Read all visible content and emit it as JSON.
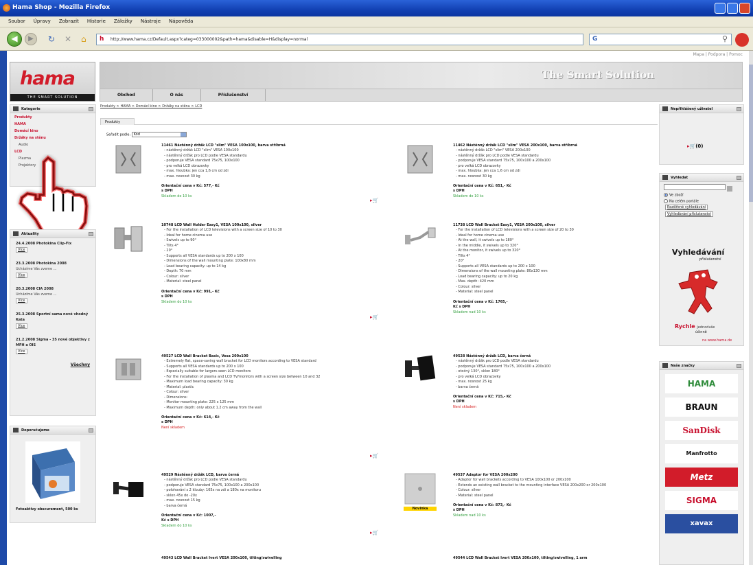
{
  "window": {
    "title": "Hama Shop - Mozilla Firefox"
  },
  "menu": [
    "Soubor",
    "Úpravy",
    "Zobrazit",
    "Historie",
    "Záložky",
    "Nástroje",
    "Nápověda"
  ],
  "nav": {
    "url": "http://www.hama.cz/Default.aspx?categ=033000002&path=hama&disable=H&display=normal",
    "search_placeholder": "Google"
  },
  "header": {
    "toplinks": "Mapa | Podpora | Pomoc",
    "logo": "hama",
    "logo_strip": "THE SMART SOLUTION",
    "slogan": "The Smart Solution",
    "tabs": [
      "Obchod",
      "O nás",
      "Příslušenství"
    ]
  },
  "sidebar": {
    "categories_title": "Kategorie",
    "categories": [
      {
        "label": "Produkty",
        "sub": false
      },
      {
        "label": "HAMA",
        "sub": false
      },
      {
        "label": "Domácí kino",
        "sub": false
      },
      {
        "label": "Držáky na stěnu",
        "sub": false
      },
      {
        "label": "Audio",
        "sub": true
      },
      {
        "label": "LCD",
        "sub": false
      },
      {
        "label": "Plazma",
        "sub": true
      },
      {
        "label": "Projektory",
        "sub": true
      }
    ],
    "news_title": "Aktuality",
    "news": [
      {
        "title": "24.4.2008 Photokina Clip-Fix",
        "desc": "",
        "more": "Více"
      },
      {
        "title": "23.3.2008 Photokina 2008",
        "desc": "Ucházíme Vás zveme ...",
        "more": "Více"
      },
      {
        "title": "20.3.2008 CIA 2008",
        "desc": "Ucházíme Vás zveme ...",
        "more": "Více"
      },
      {
        "title": "25.3.2008 Sportní sama nové vhodný Kata",
        "desc": "",
        "more": "Více"
      },
      {
        "title": "21.2.2008 Sigma - 35 nové objektivy z MFH a OIS",
        "desc": "",
        "more": "Více"
      }
    ],
    "news_all": "Všechny",
    "promo_title": "Doporučujeme",
    "promo_caption": "Fotoaktivy obscurement, 500 ks"
  },
  "main": {
    "breadcrumb": "Produkty > HAMA > Domácí kino > Držáky na stěnu > LCD",
    "tab": "Produkty",
    "sort_label": "Seřadit podle:",
    "sort_value": "Kód",
    "products": [
      {
        "name": "11461 Nástěnný držák LCD \"slim\" VESA 100x100, barva stříbrná",
        "features": [
          "nástěnný držák LCD \"slim\" VESA 100x100",
          "nástěnný držák pro LCD podle VESA standardu",
          "podporuje VESA standard 75x75, 100x100",
          "pro velká LCD obrazovky",
          "max. hloubka: jen cca 1,6 cm od zdi",
          "max. nosnost 30 kg"
        ],
        "price": "Orientační cena v Kč: 577,- Kč",
        "price2": "s DPH",
        "availability": "Skladem do 10 ks",
        "avail_color": "green"
      },
      {
        "name": "11462 Nástěnný držák LCD \"slim\" VESA 200x100, barva stříbrná",
        "features": [
          "nástěnný držák LCD \"slim\" VESA 200x100",
          "nástěnný držák pro LCD podle VESA standardu",
          "podporuje VESA standard 75x75, 100x100 a 200x100",
          "pro velká LCD obrazovky",
          "max. hloubka: jen cca 1,6 cm od zdi",
          "max. nosnost 30 kg"
        ],
        "price": "Orientační cena v Kč: 651,- Kč",
        "price2": "s DPH",
        "availability": "Skladem do 10 ks",
        "avail_color": "green"
      },
      {
        "name": "10748 LCD Wall Holder Easy1, VESA 100x100, silver",
        "features": [
          "For the installation of LCD televisions with a screen size of 10 to 30",
          "Ideal for home cinema use",
          "Swivels up to 90°",
          "Tilts 4°",
          "20°",
          "Supports all VESA standards up to 200 x 100",
          "Dimensions of the wall mounting plate: 100x80 mm",
          "Load bearing capacity: up to 14 kg",
          "Depth: 70 mm",
          "Colour: silver",
          "Material: steel panel"
        ],
        "price": "Orientační cena v Kč: 991,- Kč",
        "price2": "s DPH",
        "availability": "Skladem do 10 ks",
        "avail_color": "green"
      },
      {
        "name": "11738 LCD Wall Bracket Easy1, VESA 200x100, silver",
        "features": [
          "For the installation of LCD televisions with a screen size of 20 to 30",
          "Ideal for home cinema use",
          "At the wall, it swivels up to 180°",
          "In the middle, it swivels up to 320°",
          "At the monitor, it swivels up to 320°",
          "Tilts 4°",
          "20°",
          "Supports all VESA standards up to 200 x 100",
          "Dimensions of the wall mounting plate: 80x130 mm",
          "Load bearing capacity: up to 20 kg",
          "Max. depth: 420 mm",
          "Colour: silver",
          "Material: steel panel"
        ],
        "price": "Orientační cena v Kč: 1765,-",
        "price2": "Kč s DPH",
        "availability": "Skladem nad 10 ks",
        "avail_color": "green"
      },
      {
        "name": "49527 LCD Wall Bracket Basic, Vesa 200x100",
        "features": [
          "Extremely flat, space-saving wall bracket for LCD monitors according to VESA standard",
          "Supports all VESA standards up to 200 x 100",
          "Especially suitable for largers-seen LCD monitors",
          "For the installation of plasma and LCD TV/monitors with a screen size between 10 and 32",
          "Maximum load bearing capacity: 30 kg",
          "Material: plastic",
          "Colour: silver",
          "Dimensions:",
          "Monitor mounting plate: 225 x 125 mm",
          "Maximum depth: only about 1.2 cm away from the wall"
        ],
        "price": "Orientační cena v Kč: 614,- Kč",
        "price2": "s DPH",
        "availability": "Není skladem",
        "avail_color": "red"
      },
      {
        "name": "49528 Nástěnný držák LCD, barva černá",
        "features": [
          "nástěnný držák pro LCD podle VESA standardu",
          "podporuje VESA standard 75x75, 100x100 a 200x100",
          "otočný 130°, sklon 180°",
          "pro velká LCD obrazovky",
          "max. nosnost 25 kg",
          "barva černá"
        ],
        "price": "Orientační cena v Kč: 715,- Kč",
        "price2": "s DPH",
        "availability": "Není skladem",
        "avail_color": "red"
      },
      {
        "name": "49529 Nástěnný držák LCD, barva černá",
        "features": [
          "nástěnný držák pro LCD podle VESA standardu",
          "podporuje VESA standard 75x75, 100x100 a 200x100",
          "polohování s 2 klouby: 165x na zdi a 180x na monitoru",
          "sklon 45x do -20x",
          "max. nosnost 15 kg",
          "barva černá"
        ],
        "price": "Orientační cena v Kč: 1007,-",
        "price2": "Kč s DPH",
        "availability": "Skladem do 10 ks",
        "avail_color": "green"
      },
      {
        "name": "49537 Adaptor for VESA 200x200",
        "features": [
          "Adaptor for wall brackets according to VESA 100x100 or 200x100",
          "Extends an existing wall bracket to the mounting interface VESA 200x200 or 200x100",
          "Colour: silver",
          "Material: steel panel"
        ],
        "price": "Orientační cena v Kč: 873,- Kč",
        "price2": "s DPH",
        "availability": "Skladem nad 10 ks",
        "avail_color": "green",
        "badge": "Novinka"
      }
    ],
    "bottom_items": [
      "49543 LCD Wall Bracket Ivert VESA 200x100, tilting/swivelling",
      "49544 LCD Wall Bracket Ivert VESA 200x100, tilting/swivelling, 1 arm"
    ]
  },
  "right": {
    "cart_title": "Nepřihlášený uživatel",
    "cart_count": "(0)",
    "search_title": "Vyhledat",
    "search_opt1": "Ve zboží",
    "search_opt2": "Na celém portále",
    "search_link1": "Rozšířené vyhledávání",
    "search_link2": "Vyhledávání příslušenství",
    "promo_line1": "Vyhledávání",
    "promo_line2": "příslušenství",
    "promo_line3": "Rychle",
    "promo_line4": "jednoduše",
    "promo_line5": "účinně",
    "promo_url": "na www.hama.de",
    "brands_title": "Naše značky",
    "brands": [
      {
        "name": "HAMA",
        "color": "#2e8b3a"
      },
      {
        "name": "BRAUN",
        "color": "#111111"
      },
      {
        "name": "SanDisk",
        "color": "#c8102e"
      },
      {
        "name": "Manfrotto",
        "color": "#111111"
      },
      {
        "name": "Metz",
        "color": "#ffffff"
      },
      {
        "name": "SIGMA",
        "color": "#c8102e"
      },
      {
        "name": "xavax",
        "color": "#ffffff"
      }
    ]
  }
}
